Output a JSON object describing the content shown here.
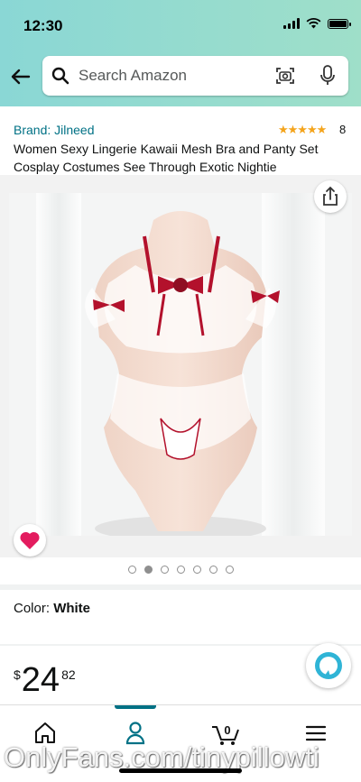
{
  "status_bar": {
    "time": "12:30",
    "icons": [
      "signal-icon",
      "wifi-icon",
      "battery-icon"
    ]
  },
  "search": {
    "placeholder": "Search Amazon",
    "icons": [
      "search-icon",
      "camera-icon",
      "mic-icon"
    ]
  },
  "product": {
    "brand": "Brand: Jilneed",
    "rating_stars": 4.5,
    "stars_display": "★★★★★",
    "rating_count": "8",
    "title": "Women Sexy Lingerie Kawaii Mesh Bra and Panty Set Cosplay Costumes See Through Exotic Nightie",
    "image_count": 7,
    "active_image_index": 1
  },
  "color": {
    "label": "Color:",
    "value": "White"
  },
  "price": {
    "symbol": "$",
    "whole": "24",
    "fraction": "82"
  },
  "tabs": [
    "home-icon",
    "account-icon",
    "cart-icon",
    "menu-icon"
  ],
  "cart_count": "0",
  "watermark": "OnlyFans.com/tinypillowti",
  "colors": {
    "header": "#8ad7d5",
    "link": "#007185",
    "star": "#f4a41c",
    "heart": "#e31c5f"
  }
}
